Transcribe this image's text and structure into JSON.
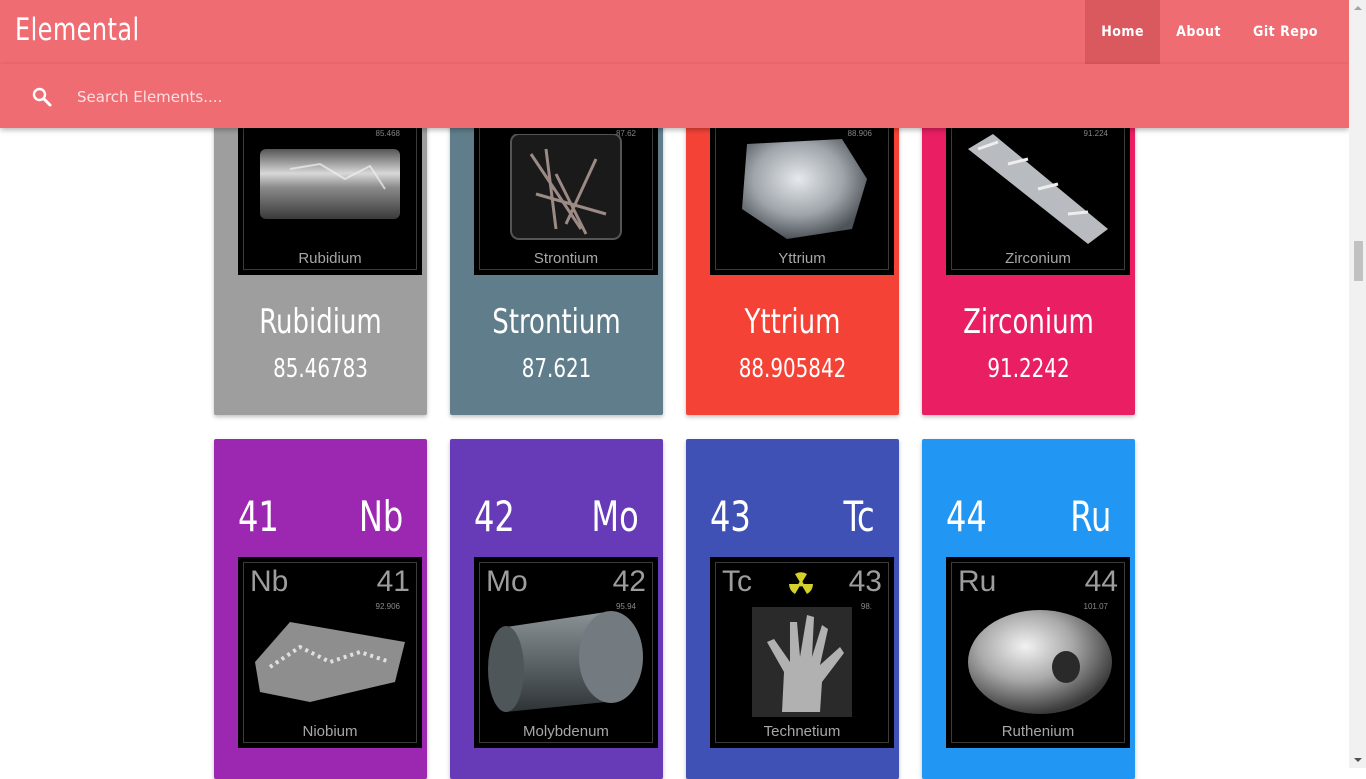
{
  "app": {
    "brand": "Elemental"
  },
  "nav": {
    "home": "Home",
    "about": "About",
    "git_repo": "Git Repo"
  },
  "search": {
    "placeholder": "Search Elements...."
  },
  "colors": {
    "navbar": "#ef6c72",
    "rubidium": "#9e9e9e",
    "strontium": "#607d8b",
    "yttrium": "#f44336",
    "zirconium": "#e91e63",
    "niobium": "#9c27b0",
    "molybdenum": "#673ab7",
    "technetium": "#3f51b5",
    "ruthenium": "#2196f3"
  },
  "row1": [
    {
      "name": "Rubidium",
      "mass": "85.46783",
      "tile_mass": "85.468",
      "tile_name": "Rubidium"
    },
    {
      "name": "Strontium",
      "mass": "87.621",
      "tile_mass": "87.62",
      "tile_name": "Strontium"
    },
    {
      "name": "Yttrium",
      "mass": "88.905842",
      "tile_mass": "88.906",
      "tile_name": "Yttrium"
    },
    {
      "name": "Zirconium",
      "mass": "91.2242",
      "tile_mass": "91.224",
      "tile_name": "Zirconium"
    }
  ],
  "row2": [
    {
      "number": "41",
      "symbol": "Nb",
      "tile_symbol": "Nb",
      "tile_number": "41",
      "tile_mass": "92.906",
      "tile_name": "Niobium"
    },
    {
      "number": "42",
      "symbol": "Mo",
      "tile_symbol": "Mo",
      "tile_number": "42",
      "tile_mass": "95.94",
      "tile_name": "Molybdenum"
    },
    {
      "number": "43",
      "symbol": "Tc",
      "tile_symbol": "Tc",
      "tile_number": "43",
      "tile_mass": "98.",
      "tile_name": "Technetium"
    },
    {
      "number": "44",
      "symbol": "Ru",
      "tile_symbol": "Ru",
      "tile_number": "44",
      "tile_mass": "101.07",
      "tile_name": "Ruthenium"
    }
  ]
}
